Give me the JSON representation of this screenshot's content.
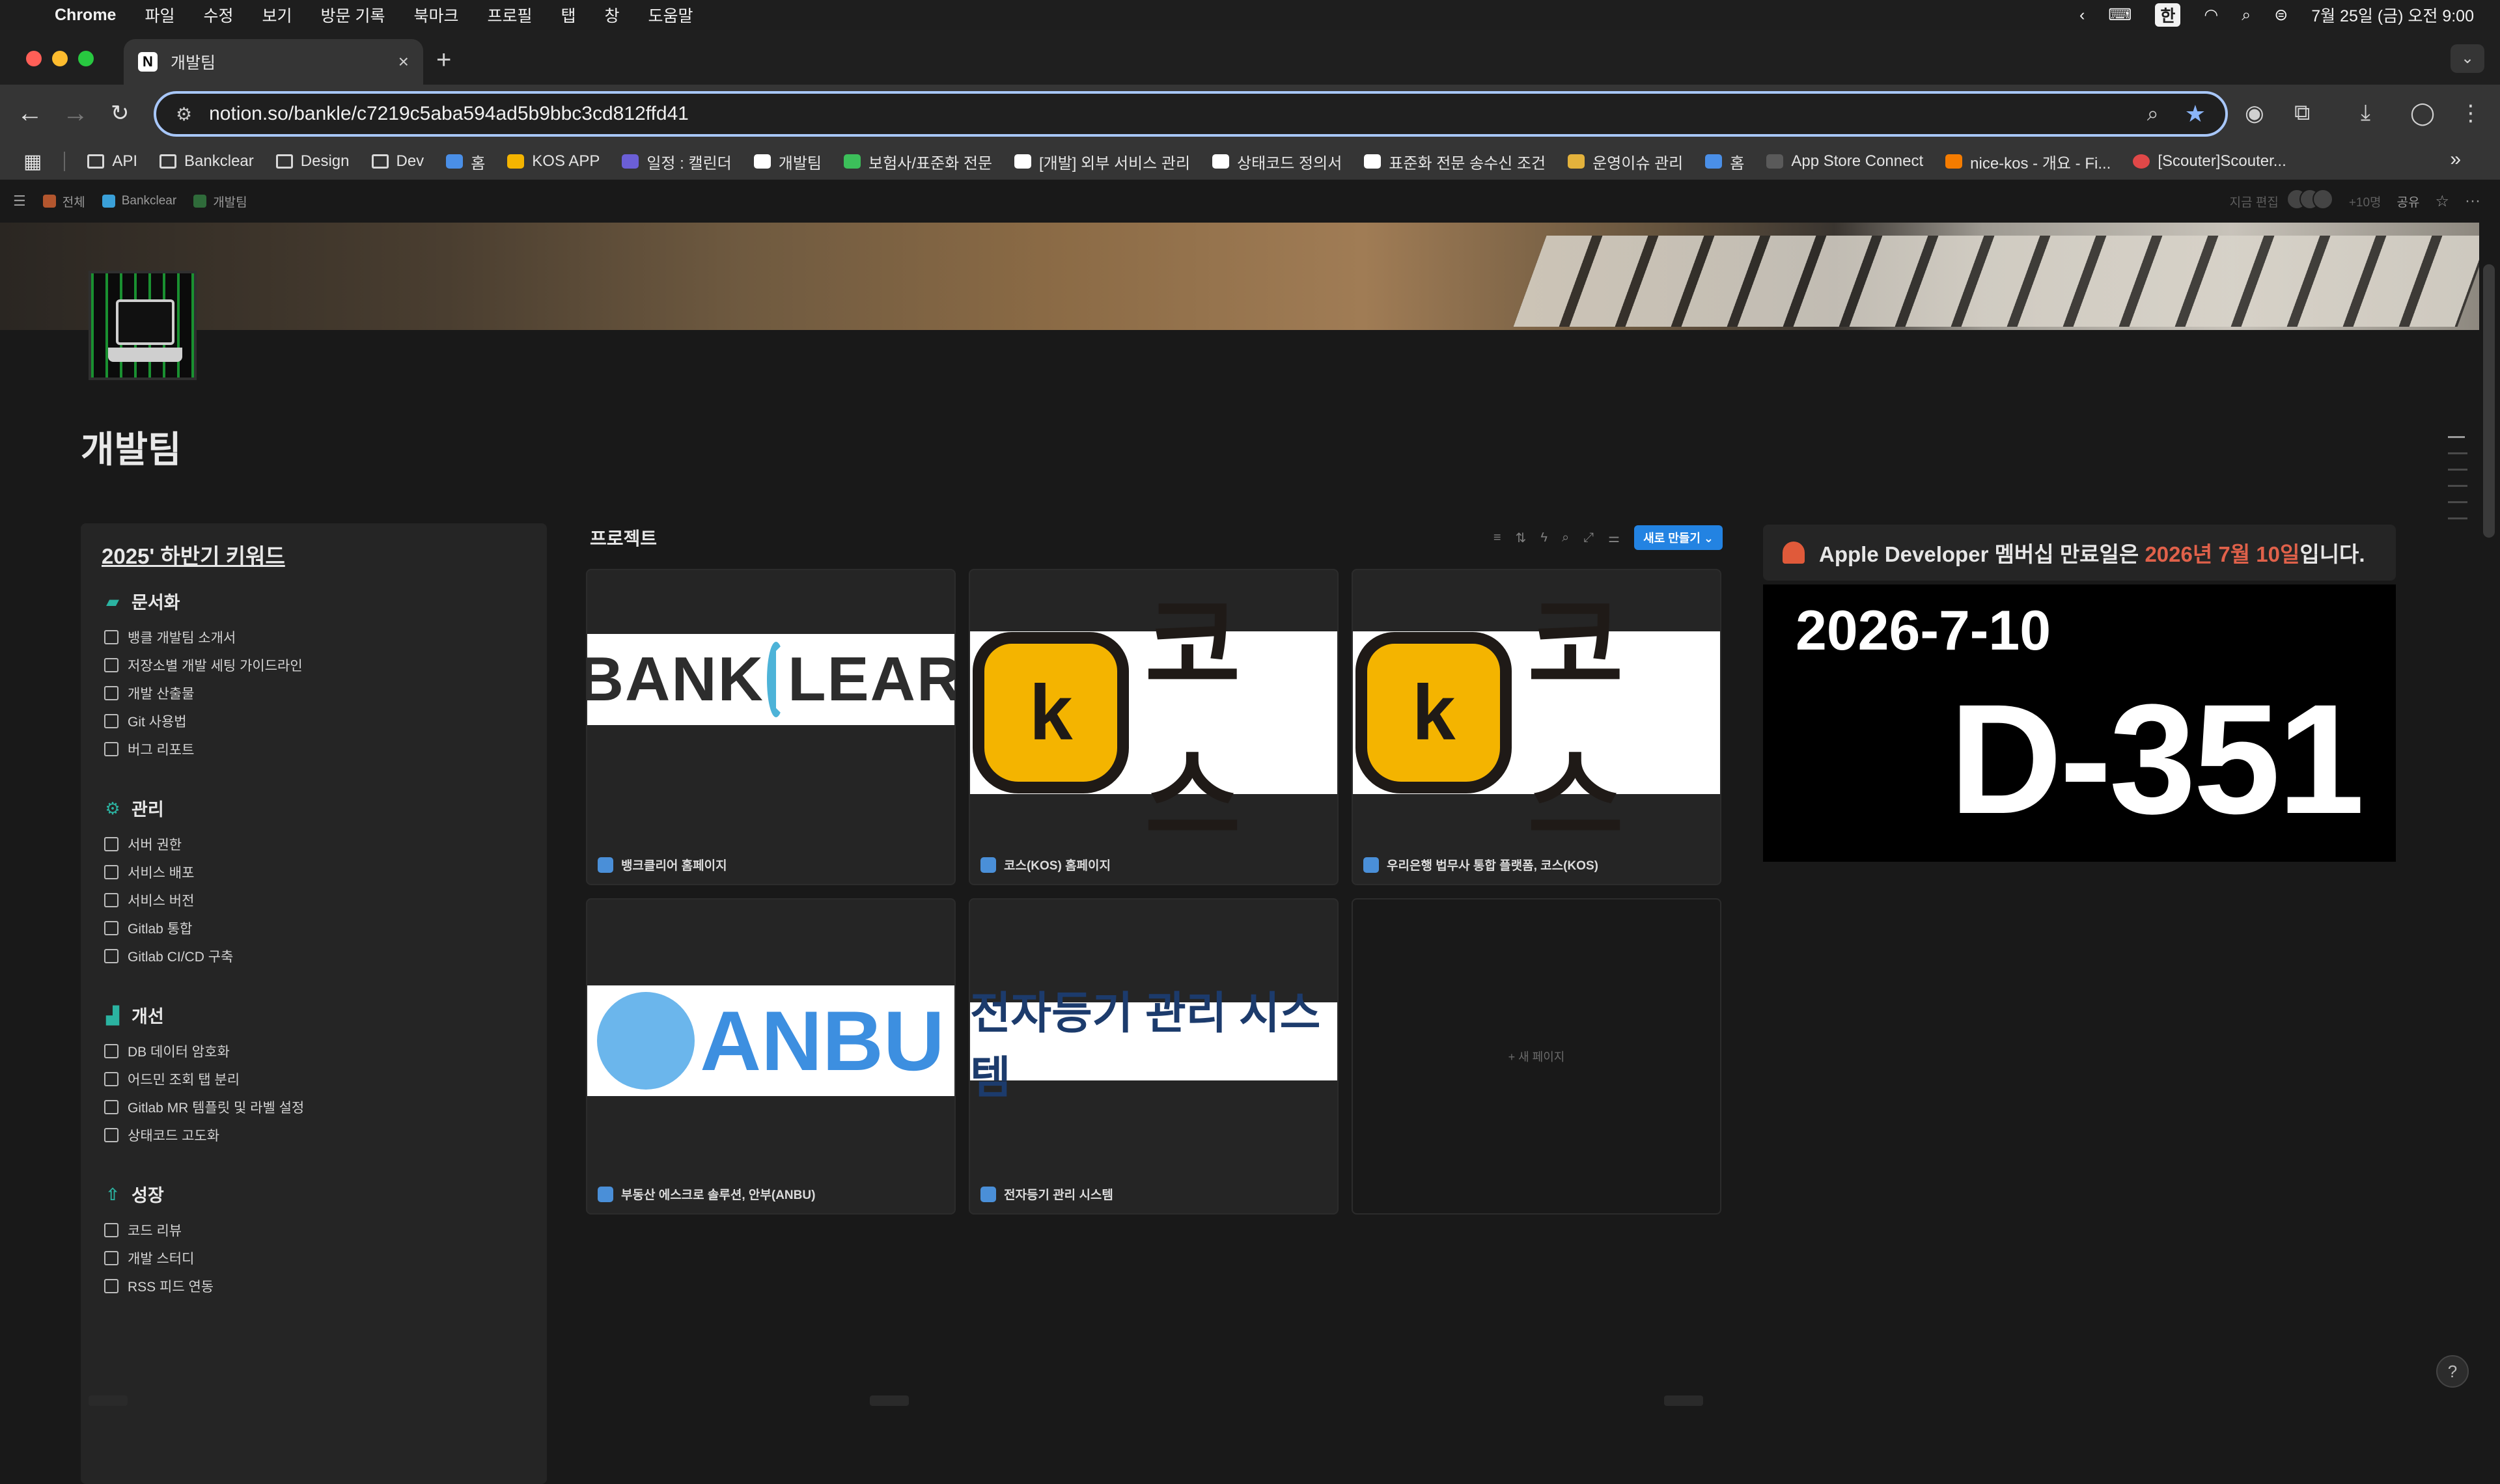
{
  "menubar": {
    "app": "Chrome",
    "items": [
      "파일",
      "수정",
      "보기",
      "방문 기록",
      "북마크",
      "프로필",
      "탭",
      "창",
      "도움말"
    ],
    "ime": "한",
    "datetime": "7월 25일 (금) 오전 9:00"
  },
  "tab": {
    "title": "개발팀",
    "favicon": "N"
  },
  "toolbar": {
    "url": "notion.so/bankle/c7219c5aba594ad5b9bbc3cd812ffd41"
  },
  "bookmarks": [
    {
      "label": "API",
      "icon": "folder-icon"
    },
    {
      "label": "Bankclear",
      "icon": "folder-icon"
    },
    {
      "label": "Design",
      "icon": "folder-icon"
    },
    {
      "label": "Dev",
      "icon": "folder-icon"
    },
    {
      "label": "홈",
      "icon": "home-icon",
      "color": "#4a8fe7"
    },
    {
      "label": "KOS APP",
      "icon": "kos-icon",
      "color": "#f4b400"
    },
    {
      "label": "일정 : 캘린더",
      "icon": "calendar-icon",
      "color": "#6b5fd6"
    },
    {
      "label": "개발팀",
      "icon": "notion-icon",
      "color": "#ffffff"
    },
    {
      "label": "보험사/표준화 전문",
      "icon": "puzzle-icon",
      "color": "#3cbf5a"
    },
    {
      "label": "[개발] 외부 서비스 관리",
      "icon": "notion-icon",
      "color": "#ffffff"
    },
    {
      "label": "상태코드 정의서",
      "icon": "notion-icon",
      "color": "#ffffff"
    },
    {
      "label": "표준화 전문 송수신 조건",
      "icon": "notion-icon",
      "color": "#ffffff"
    },
    {
      "label": "운영이슈 관리",
      "icon": "board-icon",
      "color": "#e3b23c"
    },
    {
      "label": "홈",
      "icon": "jira-icon",
      "color": "#4a8fe7"
    },
    {
      "label": "App Store Connect",
      "icon": "apple-icon",
      "color": "#cfcfcf"
    },
    {
      "label": "nice-kos - 개요 - Fi...",
      "icon": "firebase-icon",
      "color": "#f57c00"
    },
    {
      "label": "[Scouter]Scouter...",
      "icon": "scouter-icon",
      "color": "#e04848"
    }
  ],
  "notion": {
    "breadcrumbs": [
      "전체",
      "Bankclear",
      "개발팀"
    ],
    "top_right": {
      "edit_time": "지금 편집",
      "members": "+10명",
      "share": "공유"
    },
    "page_title": "개발팀",
    "keywords": {
      "title": "2025' 하반기 키워드",
      "sections": [
        {
          "heading": "문서화",
          "icon": "folder-open-icon",
          "items": [
            "뱅클 개발팀 소개서",
            "저장소별 개발 세팅 가이드라인",
            "개발 산출물",
            "Git 사용법",
            "버그 리포트"
          ]
        },
        {
          "heading": "관리",
          "icon": "gear-icon",
          "items": [
            "서버 권한",
            "서비스 배포",
            "서비스 버전",
            "Gitlab 통합",
            "Gitlab CI/CD 구축"
          ]
        },
        {
          "heading": "개선",
          "icon": "chart-icon",
          "items": [
            "DB 데이터 암호화",
            "어드민 조회 탭 분리",
            "Gitlab MR 템플릿 및 라벨 설정",
            "상태코드 고도화"
          ]
        },
        {
          "heading": "성장",
          "icon": "level-up-icon",
          "items": [
            "코드 리뷰",
            "개발 스터디",
            "RSS 피드 연동"
          ]
        }
      ]
    },
    "projects": {
      "title": "프로젝트",
      "new_button": "새로 만들기",
      "cards": [
        {
          "caption": "뱅크클리어 홈페이지",
          "logo": "BANKCLEAR"
        },
        {
          "caption": "코스(KOS) 홈페이지",
          "logo": "코스"
        },
        {
          "caption": "우리은행 법무사 통합 플랫폼, 코스(KOS)",
          "logo": "코스"
        },
        {
          "caption": "부동산 에스크로 솔루션, 안부(ANBU)",
          "logo": "ANBU"
        },
        {
          "caption": "전자등기 관리 시스템",
          "logo": "전자등기 관리 시스템"
        }
      ],
      "new_page": "+ 새 페이지"
    },
    "callout": {
      "prefix": "Apple Developer 멤버십 만료일은 ",
      "highlight": "2026년 7월 10일",
      "suffix": "입니다."
    },
    "dday": {
      "date": "2026-7-10",
      "count": "D-351"
    }
  }
}
